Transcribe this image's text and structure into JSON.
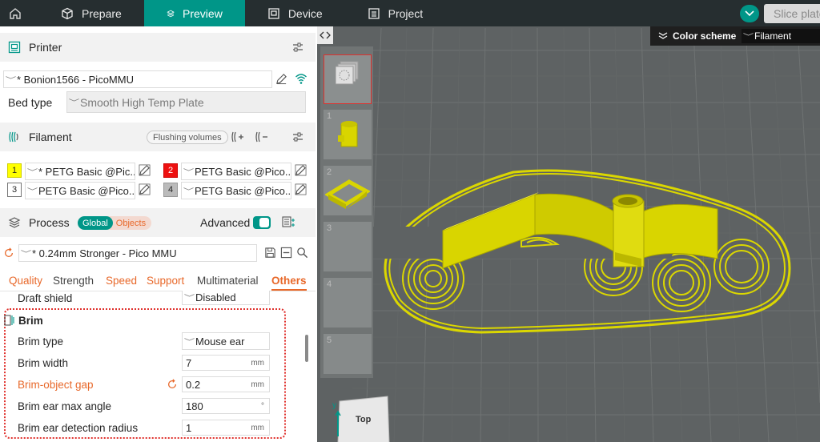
{
  "topbar": {
    "tabs": [
      {
        "label": "Prepare",
        "icon": "cube-icon"
      },
      {
        "label": "Preview",
        "icon": "layers-icon"
      },
      {
        "label": "Device",
        "icon": "device-icon"
      },
      {
        "label": "Project",
        "icon": "project-icon"
      }
    ],
    "slice_label": "Slice plate"
  },
  "printer": {
    "title": "Printer",
    "selected": "* Bonion1566 - PicoMMU",
    "bed_label": "Bed type",
    "bed_value": "Smooth High Temp Plate"
  },
  "filament": {
    "title": "Filament",
    "flushing": "Flushing volumes",
    "slots": [
      {
        "num": "1",
        "name": "* PETG Basic @Pic...",
        "color": "#ffff00",
        "text_color": "#262626"
      },
      {
        "num": "2",
        "name": "PETG Basic @Pico...",
        "color": "#ee1111",
        "text_color": "#ffffff"
      },
      {
        "num": "3",
        "name": "PETG Basic @Pico...",
        "color": "#ffffff",
        "text_color": "#262626"
      },
      {
        "num": "4",
        "name": "PETG Basic @Pico...",
        "color": "#bbbbbb",
        "text_color": "#262626"
      }
    ]
  },
  "process": {
    "title": "Process",
    "toggle_global": "Global",
    "toggle_objects": "Objects",
    "advanced": "Advanced",
    "preset": "* 0.24mm Stronger - Pico MMU",
    "tabs": [
      "Quality",
      "Strength",
      "Speed",
      "Support",
      "Multimaterial",
      "Others"
    ],
    "draft_shield_label": "Draft shield",
    "draft_shield_value": "Disabled",
    "brim_title": "Brim",
    "brim": [
      {
        "label": "Brim type",
        "value": "Mouse ear",
        "unit": "",
        "modified": false,
        "combo": true
      },
      {
        "label": "Brim width",
        "value": "7",
        "unit": "mm",
        "modified": false,
        "combo": false
      },
      {
        "label": "Brim-object gap",
        "value": "0.2",
        "unit": "mm",
        "modified": true,
        "combo": false
      },
      {
        "label": "Brim ear max angle",
        "value": "180",
        "unit": "°",
        "modified": false,
        "combo": false
      },
      {
        "label": "Brim ear detection radius",
        "value": "1",
        "unit": "mm",
        "modified": false,
        "combo": false
      }
    ]
  },
  "viewport": {
    "color_scheme_label": "Color scheme",
    "color_scheme_value": "Filament",
    "plates": [
      "1",
      "2",
      "3",
      "4",
      "5"
    ],
    "cube_label": "Top"
  },
  "colors": {
    "accent": "#009688",
    "modified": "#e8692b",
    "model": "#dbd700",
    "highlight": "#e0312d"
  }
}
